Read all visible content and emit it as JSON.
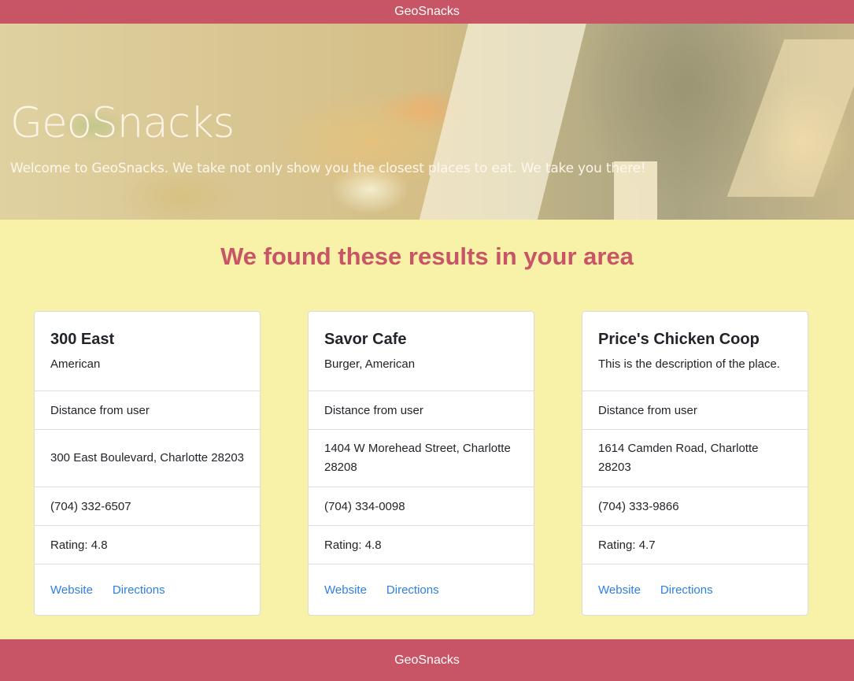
{
  "navbar": {
    "brand": "GeoSnacks"
  },
  "hero": {
    "title": "GeoSnacks",
    "subtitle": "Welcome to GeoSnacks. We take not only show you the closest places to eat. We take you there!"
  },
  "results": {
    "heading": "We found these results in your area",
    "cards": [
      {
        "name": "300 East",
        "description": "American",
        "distance": "Distance from user",
        "address": "300 East Boulevard, Charlotte 28203",
        "phone": "(704) 332-6507",
        "rating": "Rating: 4.8",
        "website_label": "Website",
        "directions_label": "Directions"
      },
      {
        "name": "Savor Cafe",
        "description": "Burger, American",
        "distance": "Distance from user",
        "address": "1404 W Morehead Street, Charlotte 28208",
        "phone": "(704) 334-0098",
        "rating": "Rating: 4.8",
        "website_label": "Website",
        "directions_label": "Directions"
      },
      {
        "name": "Price's Chicken Coop",
        "description": "This is the description of the place.",
        "distance": "Distance from user",
        "address": "1614 Camden Road, Charlotte 28203",
        "phone": "(704) 333-9866",
        "rating": "Rating: 4.7",
        "website_label": "Website",
        "directions_label": "Directions"
      }
    ]
  },
  "footer": {
    "text": "GeoSnacks"
  },
  "colors": {
    "brand": "#c85565",
    "page_background": "#f8f1a8",
    "link": "#2f7fe0"
  }
}
